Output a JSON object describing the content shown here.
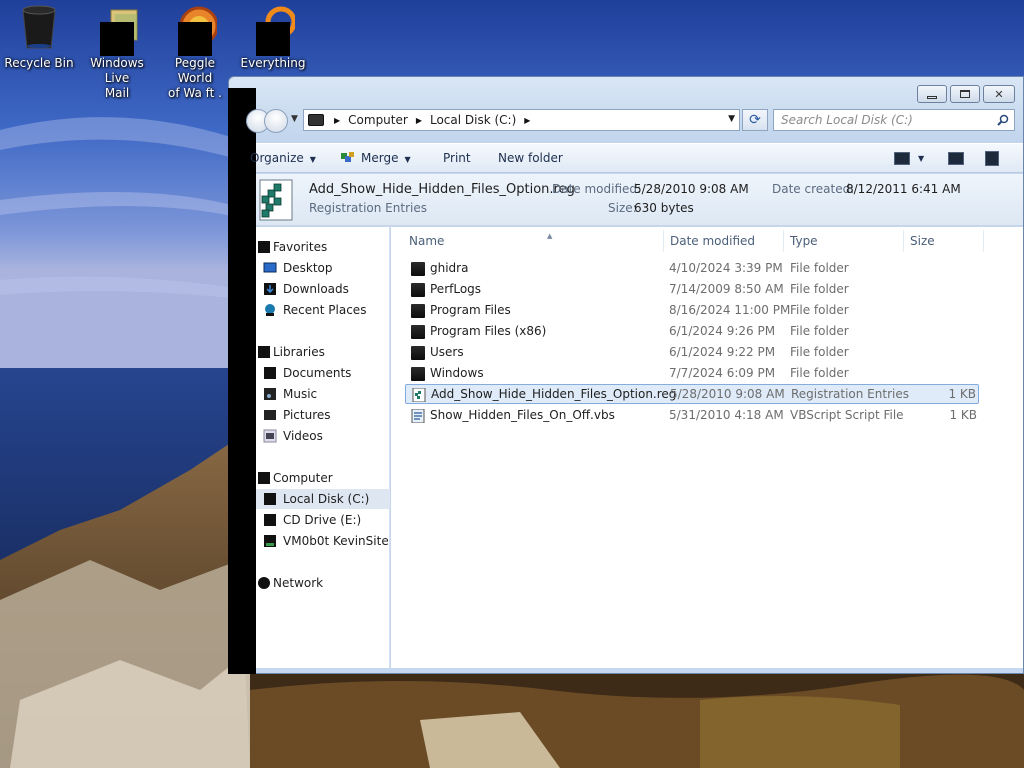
{
  "desktop": {
    "icons": [
      {
        "label": "Recycle Bin"
      },
      {
        "label": "Windows Live\nMail"
      },
      {
        "label": "Peggle World\nof Wa  ft ."
      },
      {
        "label": "Everything"
      }
    ]
  },
  "address_bar": {
    "crumbs": [
      "Computer",
      "Local Disk (C:)"
    ],
    "search_placeholder": "Search Local Disk (C:)"
  },
  "toolbar": {
    "organize": "Organize",
    "merge": "Merge",
    "print": "Print",
    "new_folder": "New folder"
  },
  "details_pane": {
    "file_name": "Add_Show_Hide_Hidden_Files_Option.reg",
    "file_type": "Registration Entries",
    "date_modified_label": "Date modified:",
    "date_modified": "5/28/2010 9:08 AM",
    "date_created_label": "Date created:",
    "date_created": "8/12/2011 6:41 AM",
    "size_label": "Size:",
    "size": "630 bytes"
  },
  "nav_pane": {
    "favorites": {
      "label": "Favorites",
      "items": [
        "Desktop",
        "Downloads",
        "Recent Places"
      ]
    },
    "libraries": {
      "label": "Libraries",
      "items": [
        "Documents",
        "Music",
        "Pictures",
        "Videos"
      ]
    },
    "computer": {
      "label": "Computer",
      "items": [
        "Local Disk (C:)",
        "CD Drive (E:)",
        "VM0b0t KevinSite"
      ],
      "selected": "Local Disk (C:)"
    },
    "network": {
      "label": "Network"
    }
  },
  "file_list": {
    "columns": [
      "Name",
      "Date modified",
      "Type",
      "Size"
    ],
    "rows": [
      {
        "name": "ghidra",
        "date": "4/10/2024 3:39 PM",
        "type": "File folder",
        "size": "",
        "icon": "folder-icon"
      },
      {
        "name": "PerfLogs",
        "date": "7/14/2009 8:50 AM",
        "type": "File folder",
        "size": "",
        "icon": "folder-icon"
      },
      {
        "name": "Program Files",
        "date": "8/16/2024 11:00 PM",
        "type": "File folder",
        "size": "",
        "icon": "folder-icon"
      },
      {
        "name": "Program Files (x86)",
        "date": "6/1/2024 9:26 PM",
        "type": "File folder",
        "size": "",
        "icon": "folder-icon"
      },
      {
        "name": "Users",
        "date": "6/1/2024 9:22 PM",
        "type": "File folder",
        "size": "",
        "icon": "folder-icon"
      },
      {
        "name": "Windows",
        "date": "7/7/2024 6:09 PM",
        "type": "File folder",
        "size": "",
        "icon": "folder-icon"
      },
      {
        "name": "Add_Show_Hide_Hidden_Files_Option.reg",
        "date": "5/28/2010 9:08 AM",
        "type": "Registration Entries",
        "size": "1 KB",
        "icon": "registry-file-icon",
        "selected": true
      },
      {
        "name": "Show_Hidden_Files_On_Off.vbs",
        "date": "5/31/2010 4:18 AM",
        "type": "VBScript Script File",
        "size": "1 KB",
        "icon": "vbscript-file-icon"
      }
    ]
  },
  "colors": {
    "selection_bg": "#dfebf9",
    "selection_border": "#84acdd",
    "window_chrome": "#c5d8ef"
  }
}
